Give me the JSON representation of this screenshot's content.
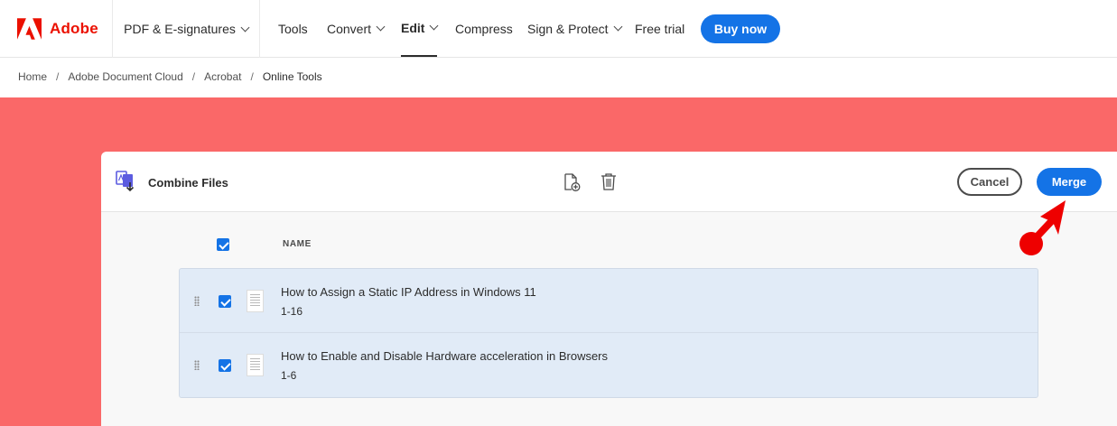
{
  "brand": {
    "name": "Adobe",
    "logo_icon": "adobe-logo-icon",
    "color": "#eb1000"
  },
  "nav": {
    "pdf_menu": "PDF & E-signatures",
    "items": [
      {
        "label": "Tools",
        "dropdown": false,
        "active": false
      },
      {
        "label": "Convert",
        "dropdown": true,
        "active": false
      },
      {
        "label": "Edit",
        "dropdown": true,
        "active": true
      },
      {
        "label": "Compress",
        "dropdown": false,
        "active": false
      },
      {
        "label": "Sign & Protect",
        "dropdown": true,
        "active": false
      },
      {
        "label": "Free trial",
        "dropdown": false,
        "active": false
      }
    ],
    "buy_label": "Buy now"
  },
  "breadcrumb": [
    "Home",
    "Adobe Document Cloud",
    "Acrobat",
    "Online Tools"
  ],
  "combine": {
    "title": "Combine Files",
    "toolbar_icons": [
      "add-file-icon",
      "trash-icon"
    ],
    "cancel_label": "Cancel",
    "merge_label": "Merge",
    "column_name": "NAME",
    "select_all_checked": true,
    "files": [
      {
        "name": "How to Assign a Static IP Address in Windows 11",
        "pages": "1-16",
        "checked": true
      },
      {
        "name": "How to Enable and Disable Hardware acceleration in Browsers",
        "pages": "1-6",
        "checked": true
      }
    ]
  },
  "colors": {
    "accent": "#1473e6",
    "hero_bg": "#fa6868",
    "annotation": "#ee0000"
  }
}
